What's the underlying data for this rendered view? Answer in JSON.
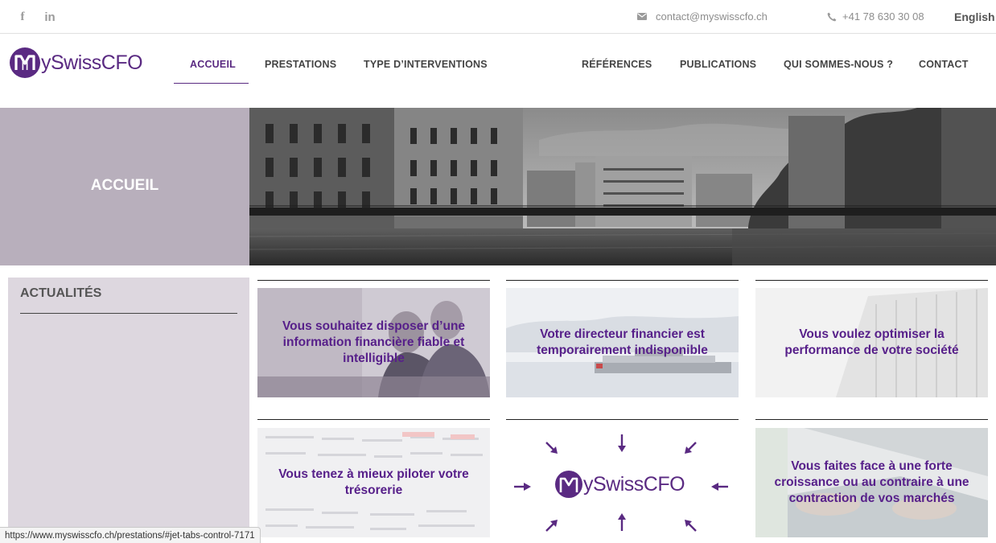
{
  "topbar": {
    "email": "contact@myswisscfo.ch",
    "phone": "+41 78 630 30 08",
    "language": "English"
  },
  "logo": {
    "prefix": "M",
    "text": "ySwissCFO"
  },
  "nav": {
    "items": [
      "ACCUEIL",
      "PRESTATIONS",
      "TYPE D’INTERVENTIONS",
      "RÉFÉRENCES",
      "PUBLICATIONS",
      "QUI SOMMES-NOUS ?",
      "CONTACT"
    ],
    "active": "ACCUEIL"
  },
  "banner": {
    "title": "ACCUEIL"
  },
  "sidebar": {
    "title": "ACTUALITÉS"
  },
  "cards": [
    "Vous souhaitez disposer d’une information financière fiable et intelligible",
    "Votre directeur financier est temporairement indisponible",
    "Vous voulez optimiser la performance de votre société",
    "Vous tenez à mieux piloter votre trésorerie",
    "MySwissCFO",
    "Vous faites face à une forte croissance ou au contraire à une contraction de vos marchés"
  ],
  "statusbar": {
    "url": "https://www.myswisscfo.ch/prestations/#jet-tabs-control-7171"
  },
  "colors": {
    "brand": "#5a2a82",
    "card_text": "#57208a",
    "banner_left": "#b8afbc",
    "sidebar": "#ddd7df"
  }
}
